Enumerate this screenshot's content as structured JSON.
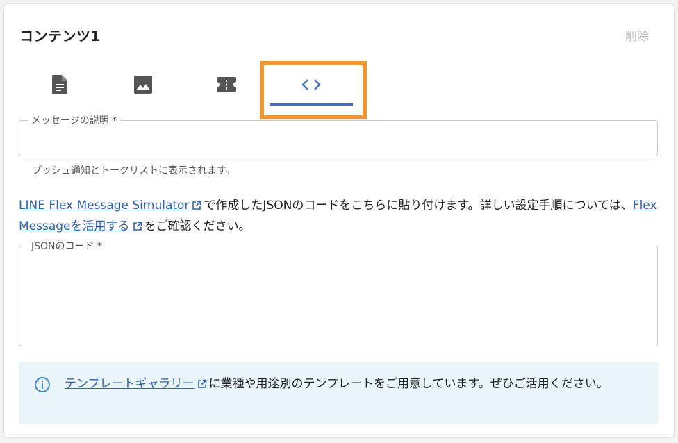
{
  "header": {
    "title": "コンテンツ1",
    "delete_label": "削除"
  },
  "tabs": [
    {
      "icon": "document-icon",
      "active": false
    },
    {
      "icon": "image-icon",
      "active": false
    },
    {
      "icon": "coupon-ticket-icon",
      "active": false
    },
    {
      "icon": "code-icon",
      "active": true
    }
  ],
  "message_field": {
    "label": "メッセージの説明 *",
    "value": "",
    "helper": "プッシュ通知とトークリストに表示されます。"
  },
  "instructions": {
    "link1": "LINE Flex Message Simulator",
    "text1": "で作成したJSONのコードをこちらに貼り付けます。詳しい設定手順については、",
    "link2": "Flex Messageを活用する",
    "text2": "をご確認ください。"
  },
  "json_field": {
    "label": "JSONのコード *",
    "value": ""
  },
  "info_box": {
    "link": "テンプレートギャラリー",
    "text": "に業種や用途別のテンプレートをご用意しています。ぜひご活用ください。"
  },
  "colors": {
    "accent": "#3e6fc9",
    "highlight_frame": "#f0982f",
    "link": "#2a63b8",
    "info_bg": "#e9f4fb"
  }
}
